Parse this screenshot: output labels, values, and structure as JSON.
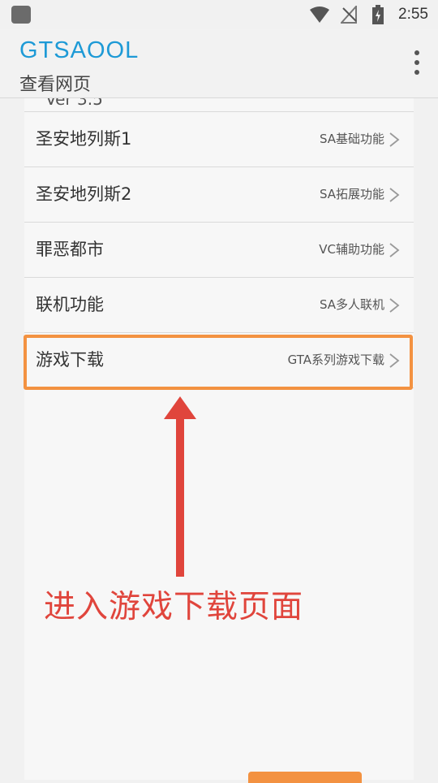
{
  "status_bar": {
    "time": "2:55"
  },
  "app_bar": {
    "title": "GTSAOOL",
    "subtitle": "查看网页"
  },
  "partial_row_text": "Ver 3.5",
  "menu_items": [
    {
      "label": "圣安地列斯1",
      "desc": "SA基础功能"
    },
    {
      "label": "圣安地列斯2",
      "desc": "SA拓展功能"
    },
    {
      "label": "罪恶都市",
      "desc": "VC辅助功能"
    },
    {
      "label": "联机功能",
      "desc": "SA多人联机"
    },
    {
      "label": "游戏下载",
      "desc": "GTA系列游戏下载"
    }
  ],
  "annotation": "进入游戏下载页面",
  "colors": {
    "title": "#1e9ad6",
    "highlight": "#f39241",
    "annotation": "#e0453c"
  }
}
